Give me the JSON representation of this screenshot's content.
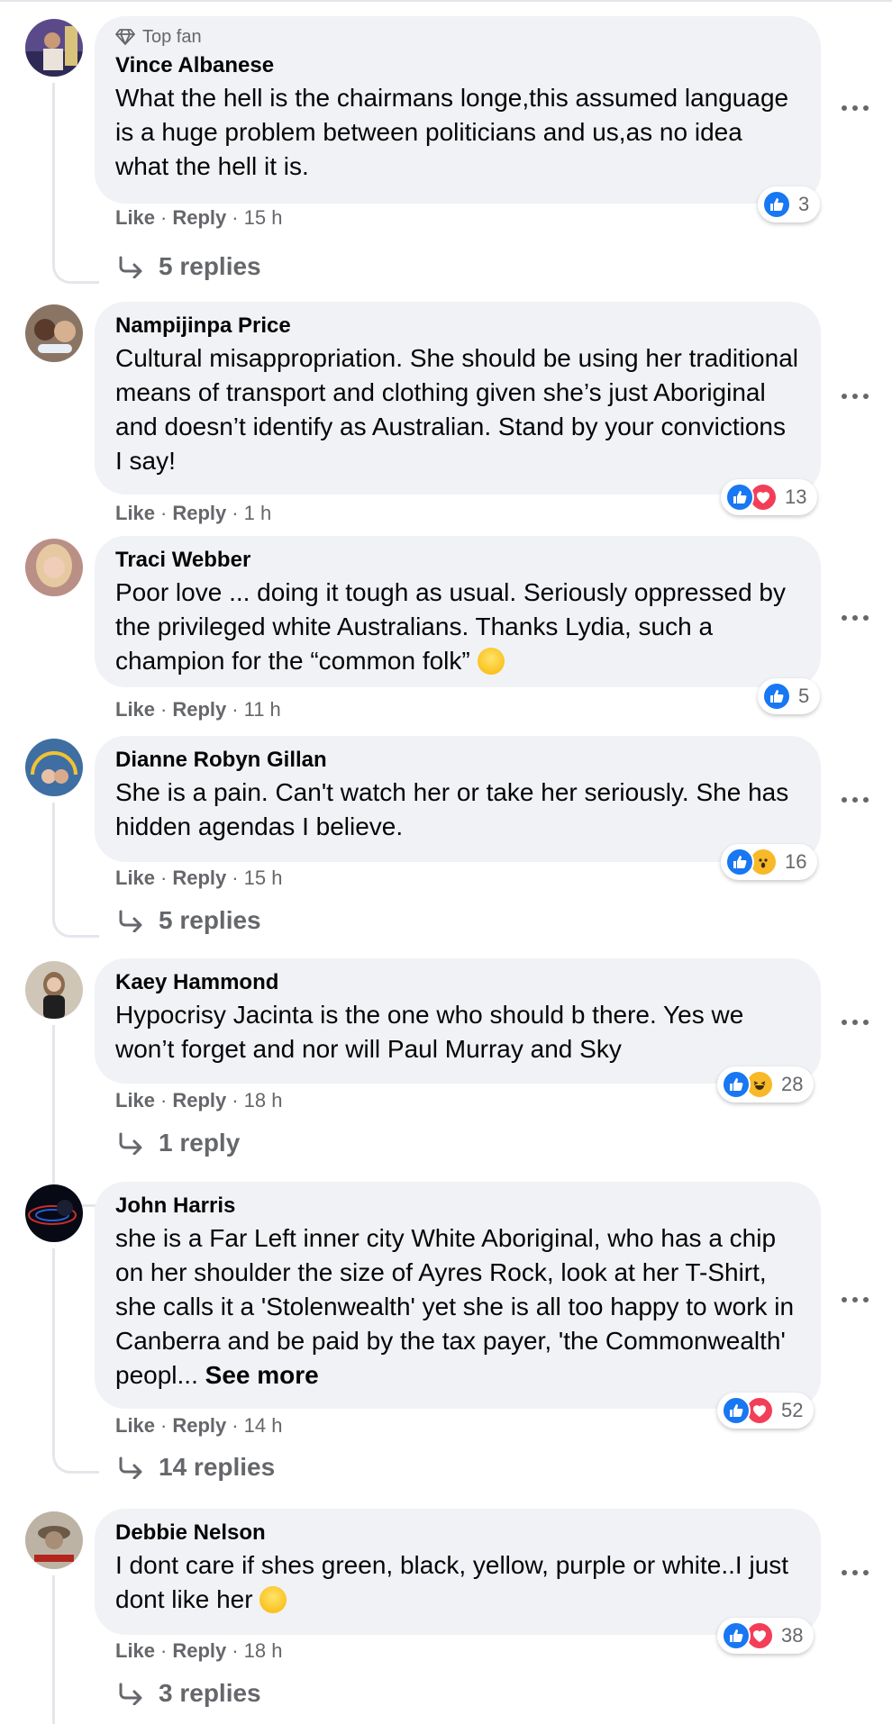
{
  "colors": {
    "background": "#ffffff",
    "bubble": "#f0f2f5",
    "secondary_text": "#65676b",
    "like_blue": "#1877f2",
    "love_red": "#f33e58",
    "emoji_yellow": "#f7b928",
    "thread_line": "#e4e6eb"
  },
  "actions": {
    "like": "Like",
    "reply": "Reply",
    "dot": "·"
  },
  "comments": [
    {
      "badge": "Top fan",
      "badge_icon": "diamond-icon",
      "author": "Vince Albanese",
      "text": "What the hell is the chairmans longe,this assumed language is a huge problem between politicians and us,as no idea what the hell it is.",
      "time": "15 h",
      "reactions": {
        "icons": [
          "like"
        ],
        "count": "3"
      },
      "replies": "5 replies"
    },
    {
      "author": "Nampijinpa Price",
      "text": "Cultural misappropriation. She should be using her traditional means of transport and clothing given she’s just Aboriginal and doesn’t identify as Australian. Stand by your convictions I say!",
      "time": "1 h",
      "reactions": {
        "icons": [
          "like",
          "love"
        ],
        "count": "13"
      }
    },
    {
      "author": "Traci Webber",
      "text": "Poor love ... doing it tough as usual. Seriously oppressed by the privileged white Australians. Thanks Lydia, such a champion for the “common folk”",
      "trailing_emoji": "grinning-squinting-face-emoji",
      "time": "11 h",
      "reactions": {
        "icons": [
          "like"
        ],
        "count": "5"
      }
    },
    {
      "author": "Dianne Robyn Gillan",
      "text": "She is a pain. Can't watch her or take her seriously. She has hidden agendas I believe.",
      "time": "15 h",
      "reactions": {
        "icons": [
          "like",
          "wow"
        ],
        "count": "16"
      },
      "replies": "5 replies"
    },
    {
      "author": "Kaey Hammond",
      "text": "Hypocrisy Jacinta is the one who should b there. Yes we won’t forget and nor will Paul Murray and Sky",
      "time": "18 h",
      "reactions": {
        "icons": [
          "like",
          "haha"
        ],
        "count": "28"
      },
      "replies": "1 reply"
    },
    {
      "author": "John Harris",
      "text": "she is a Far Left inner city White Aboriginal, who has a chip on her shoulder the size of Ayres Rock, look at her T-Shirt, she calls it a 'Stolenwealth' yet she is all too happy to work in Canberra and be paid by the tax payer, 'the Commonwealth' peopl...",
      "see_more": "See more",
      "time": "14 h",
      "reactions": {
        "icons": [
          "like",
          "love"
        ],
        "count": "52"
      },
      "replies": "14 replies"
    },
    {
      "author": "Debbie Nelson",
      "text": "I dont care if shes green, black, yellow, purple or white..I just dont like her",
      "trailing_emoji": "face-with-tears-of-joy-emoji",
      "time": "18 h",
      "reactions": {
        "icons": [
          "like",
          "love"
        ],
        "count": "38"
      },
      "replies": "3 replies"
    }
  ]
}
